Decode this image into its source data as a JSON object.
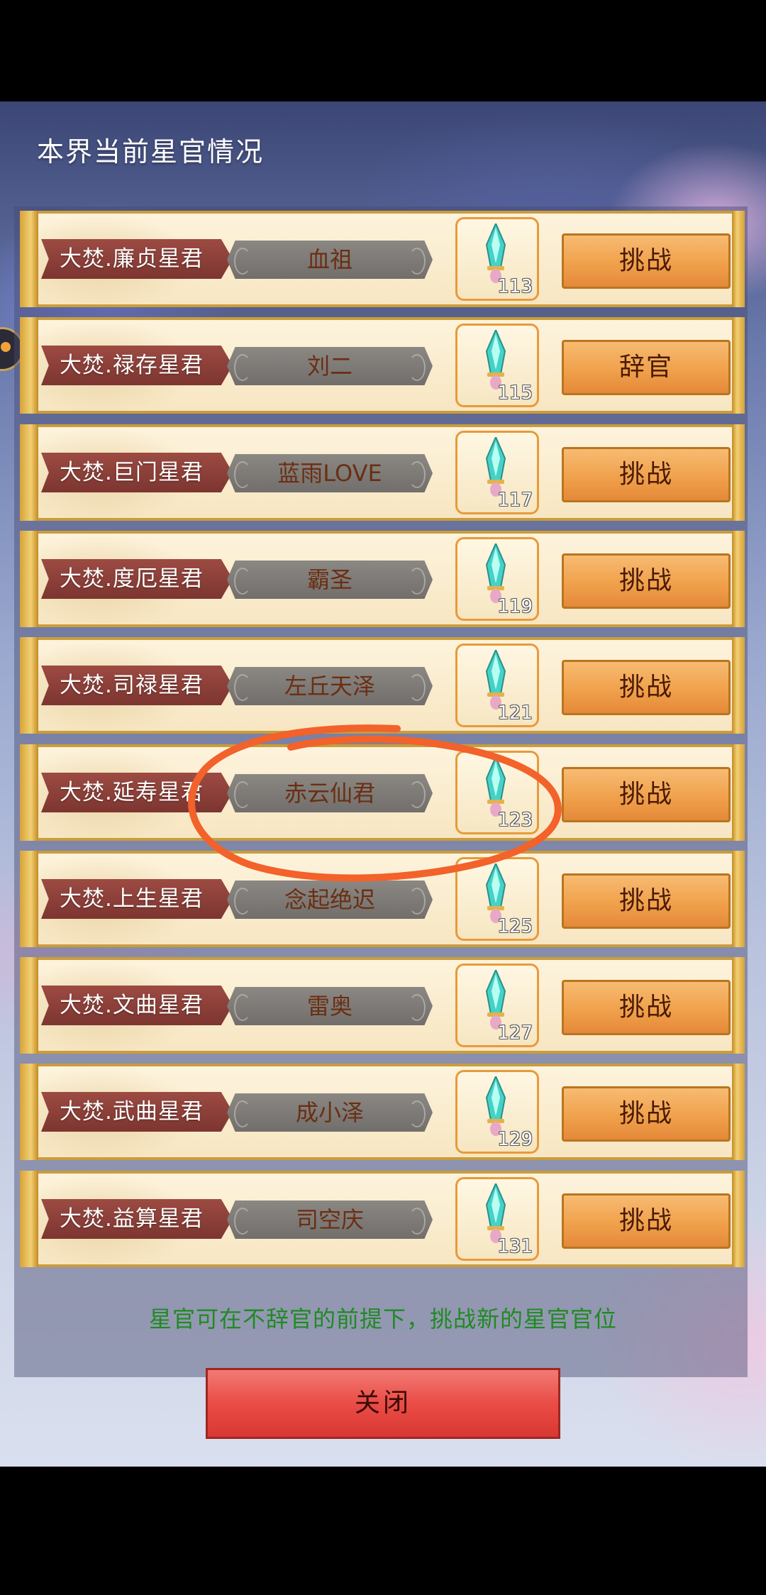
{
  "dialog": {
    "title": "本界当前星官情况",
    "notice": "星官可在不辞官的前提下，挑战新的星官官位",
    "close_label": "关闭"
  },
  "colors": {
    "ribbon": "#8b3f38",
    "action_button": "#f0a14b",
    "close_button": "#ea4c46",
    "notice_text": "#1f8a22",
    "annotation_circle": "#f2622a"
  },
  "rows": [
    {
      "title": "大焚.廉贞星君",
      "holder": "血祖",
      "level": "113",
      "action": "挑战"
    },
    {
      "title": "大焚.禄存星君",
      "holder": "刘二",
      "level": "115",
      "action": "辞官"
    },
    {
      "title": "大焚.巨门星君",
      "holder": "蓝雨LOVE",
      "level": "117",
      "action": "挑战"
    },
    {
      "title": "大焚.度厄星君",
      "holder": "霸圣",
      "level": "119",
      "action": "挑战"
    },
    {
      "title": "大焚.司禄星君",
      "holder": "左丘天泽",
      "level": "121",
      "action": "挑战"
    },
    {
      "title": "大焚.延寿星君",
      "holder": "赤云仙君",
      "level": "123",
      "action": "挑战"
    },
    {
      "title": "大焚.上生星君",
      "holder": "念起绝迟",
      "level": "125",
      "action": "挑战"
    },
    {
      "title": "大焚.文曲星君",
      "holder": "雷奥",
      "level": "127",
      "action": "挑战"
    },
    {
      "title": "大焚.武曲星君",
      "holder": "成小泽",
      "level": "129",
      "action": "挑战"
    },
    {
      "title": "大焚.益算星君",
      "holder": "司空庆",
      "level": "131",
      "action": "挑战"
    }
  ],
  "icons": {
    "item": "crystal-sword-icon",
    "side": "chat-bubble-icon"
  }
}
